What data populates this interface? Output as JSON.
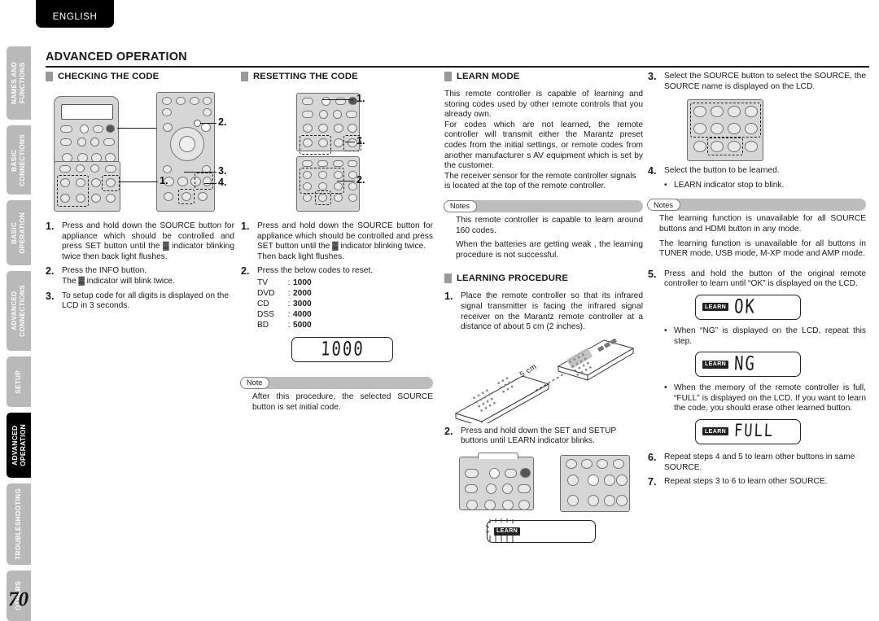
{
  "language_tab": "ENGLISH",
  "page_number": "70",
  "header": {
    "title": "ADVANCED OPERATION"
  },
  "sidebar": {
    "items": [
      {
        "label": "NAMES AND\nFUNCTIONS",
        "active": false
      },
      {
        "label": "BASIC\nCONNECTIONS",
        "active": false
      },
      {
        "label": "BASIC\nOPERATION",
        "active": false
      },
      {
        "label": "ADVANCED\nCONNECTIONS",
        "active": false
      },
      {
        "label": "SETUP",
        "active": false
      },
      {
        "label": "ADVANCED\nOPERATION",
        "active": true
      },
      {
        "label": "TROUBLESHOOTING",
        "active": false
      },
      {
        "label": "OTHERS",
        "active": false
      }
    ]
  },
  "col1": {
    "heading": "CHECKING THE CODE",
    "callouts": [
      "1.",
      "2.",
      "1.",
      "3.",
      "4."
    ],
    "steps": [
      {
        "num": "1.",
        "text": "Press and hold down the SOURCE button for appliance which should be controlled and press SET button until the ▓ indicator blinking twice then back light flushes."
      },
      {
        "num": "2.",
        "text": "Press the INFO button.\nThe ▓ indicator will blink twice."
      },
      {
        "num": "3.",
        "text": "To setup code for all digits is displayed on the LCD in 3 seconds."
      }
    ]
  },
  "col2": {
    "heading": "RESETTING THE CODE",
    "callouts": [
      "1.",
      "1.",
      "2."
    ],
    "steps": [
      {
        "num": "1.",
        "text": "Press and hold down the SOURCE button for appliance which should be controlled and press SET button until the ▓ indicator blinking twice.\nThen back light flushes."
      },
      {
        "num": "2.",
        "text": "Press the below codes to reset."
      }
    ],
    "codes": [
      {
        "key": "TV",
        "sep": ":",
        "value": "1000"
      },
      {
        "key": "DVD",
        "sep": ":",
        "value": "2000"
      },
      {
        "key": "CD",
        "sep": ":",
        "value": "3000"
      },
      {
        "key": "DSS",
        "sep": ":",
        "value": "4000"
      },
      {
        "key": "BD",
        "sep": ":",
        "value": "5000"
      }
    ],
    "lcd_value": "1000",
    "note": {
      "label": "Note",
      "lines": [
        "After this procedure, the selected SOURCE button is set initial code."
      ]
    }
  },
  "col3": {
    "heading_learn": "LEARN MODE",
    "intro_paragraphs": [
      "This remote controller is capable of learning and storing codes used by other remote controls that you already own.",
      "For codes which are not learned, the remote controller will transmit either the Marantz preset codes from the initial settings, or remote codes from another manufacturer s AV equipment which is set by the customer.",
      "The receiver sensor for the remote controller signals is located at the top of the remote controller."
    ],
    "notes": {
      "label": "Notes",
      "lines": [
        "This remote controller is capable to learn around 160 codes.",
        "When the batteries are getting weak , the learning procedure is not successful."
      ]
    },
    "heading_procedure": "LEARNING PROCEDURE",
    "step1": {
      "num": "1.",
      "text": "Place the remote controller so that its infrared signal transmitter is facing the infrared signal receiver on the Marantz remote controller at a distance of about 5 cm (2 inches)."
    },
    "diagram_distance_label": "5 cm",
    "step2": {
      "num": "2.",
      "text": "Press and hold down the SET and SETUP buttons until LEARN indicator blinks."
    },
    "lcd_learn_badge": "LEARN"
  },
  "col4": {
    "step3": {
      "num": "3.",
      "text": "Select the SOURCE button to select the SOURCE, the SOURCE name is displayed on the LCD."
    },
    "step4": {
      "num": "4.",
      "text": "Select the button to be learned.",
      "bullet": "LEARN indicator stop to blink."
    },
    "notes": {
      "label": "Notes",
      "lines": [
        "The learning function is unavailable for all SOURCE buttons and HDMI button in any mode.",
        "The learning function is unavailable for all buttons in TUNER mode, USB mode, M-XP mode and AMP mode."
      ]
    },
    "step5": {
      "num": "5.",
      "text": "Press and hold the button of the original remote controller to learn until “OK” is displayed on the LCD.",
      "lcd_ok": "OK",
      "bullet_ng": "When “NG” is displayed on the LCD, repeat this step.",
      "lcd_ng": "NG",
      "bullet_full": "When the memory of the remote controller is full, “FULL” is displayed on the LCD. If you want to learn the code, you should erase other learned button.",
      "lcd_full": "FULL"
    },
    "step6": {
      "num": "6.",
      "text": "Repeat steps 4 and 5 to learn other buttons in same SOURCE."
    },
    "step7": {
      "num": "7.",
      "text": "Repeat steps 3 to 6 to learn other SOURCE."
    },
    "lcd_learn_badge": "LEARN"
  },
  "colors": {
    "tab_inactive": "#b9b9b9",
    "tab_active": "#000000",
    "note_bar": "#bdbdbd",
    "section_square": "#9a9a9a",
    "remote_body": "#d6d6d6"
  }
}
